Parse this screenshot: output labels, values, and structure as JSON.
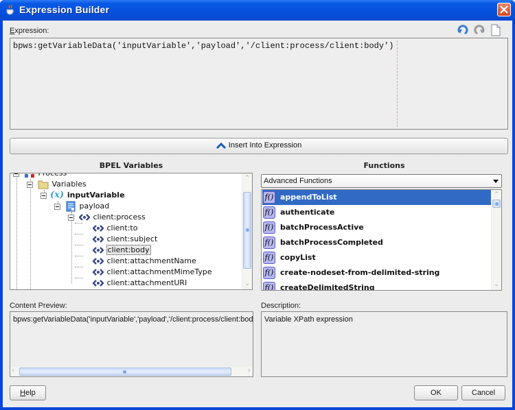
{
  "window": {
    "title": "Expression Builder",
    "icon": "java-cup-icon",
    "close_icon": "close-icon"
  },
  "toolbar": {
    "icons": [
      "undo-icon",
      "redo-icon",
      "new-document-icon"
    ]
  },
  "expression": {
    "label_mnemonic": "E",
    "label_rest": "xpression:",
    "value": "bpws:getVariableData('inputVariable','payload','/client:process/client:body')"
  },
  "insert_button": {
    "label": "Insert Into Expression",
    "icon": "chevron-up-icon"
  },
  "bpel_variables": {
    "heading": "BPEL Variables",
    "tree": [
      {
        "label": "Process",
        "icon": "process-icon",
        "level": 0,
        "expanded": true,
        "bold": false
      },
      {
        "label": "Variables",
        "icon": "folder-icon",
        "level": 1,
        "expanded": true,
        "bold": false
      },
      {
        "label": "inputVariable",
        "icon": "variable-icon",
        "level": 2,
        "expanded": true,
        "bold": true
      },
      {
        "label": "payload",
        "icon": "message-part-icon",
        "level": 3,
        "expanded": true,
        "bold": false
      },
      {
        "label": "client:process",
        "icon": "element-icon",
        "level": 4,
        "expanded": true,
        "bold": false
      },
      {
        "label": "client:to",
        "icon": "element-icon",
        "level": 5,
        "bold": false
      },
      {
        "label": "client:subject",
        "icon": "element-icon",
        "level": 5,
        "bold": false
      },
      {
        "label": "client:body",
        "icon": "element-icon",
        "level": 5,
        "bold": false,
        "selected": true
      },
      {
        "label": "client:attachmentName",
        "icon": "element-icon",
        "level": 5,
        "bold": false
      },
      {
        "label": "client:attachmentMimeType",
        "icon": "element-icon",
        "level": 5,
        "bold": false
      },
      {
        "label": "client:attachmentURI",
        "icon": "element-icon",
        "level": 5,
        "bold": false
      }
    ]
  },
  "functions": {
    "heading": "Functions",
    "category_selected": "Advanced Functions",
    "items": [
      {
        "label": "appendToList",
        "selected": true
      },
      {
        "label": "authenticate"
      },
      {
        "label": "batchProcessActive"
      },
      {
        "label": "batchProcessCompleted"
      },
      {
        "label": "copyList"
      },
      {
        "label": "create-nodeset-from-delimited-string"
      },
      {
        "label": "createDelimitedString"
      }
    ],
    "item_icon_glyph": "f()"
  },
  "content_preview": {
    "label": "Content Preview:",
    "value": "bpws:getVariableData('inputVariable','payload','/client:process/client:body')"
  },
  "description": {
    "label": "Description:",
    "value": "Variable XPath expression"
  },
  "buttons": {
    "help_mnemonic": "H",
    "help_rest": "elp",
    "ok": "OK",
    "cancel": "Cancel"
  },
  "colors": {
    "titlebar": "#0550dc",
    "selection": "#316ac5",
    "dialog_bg": "#ececec"
  }
}
